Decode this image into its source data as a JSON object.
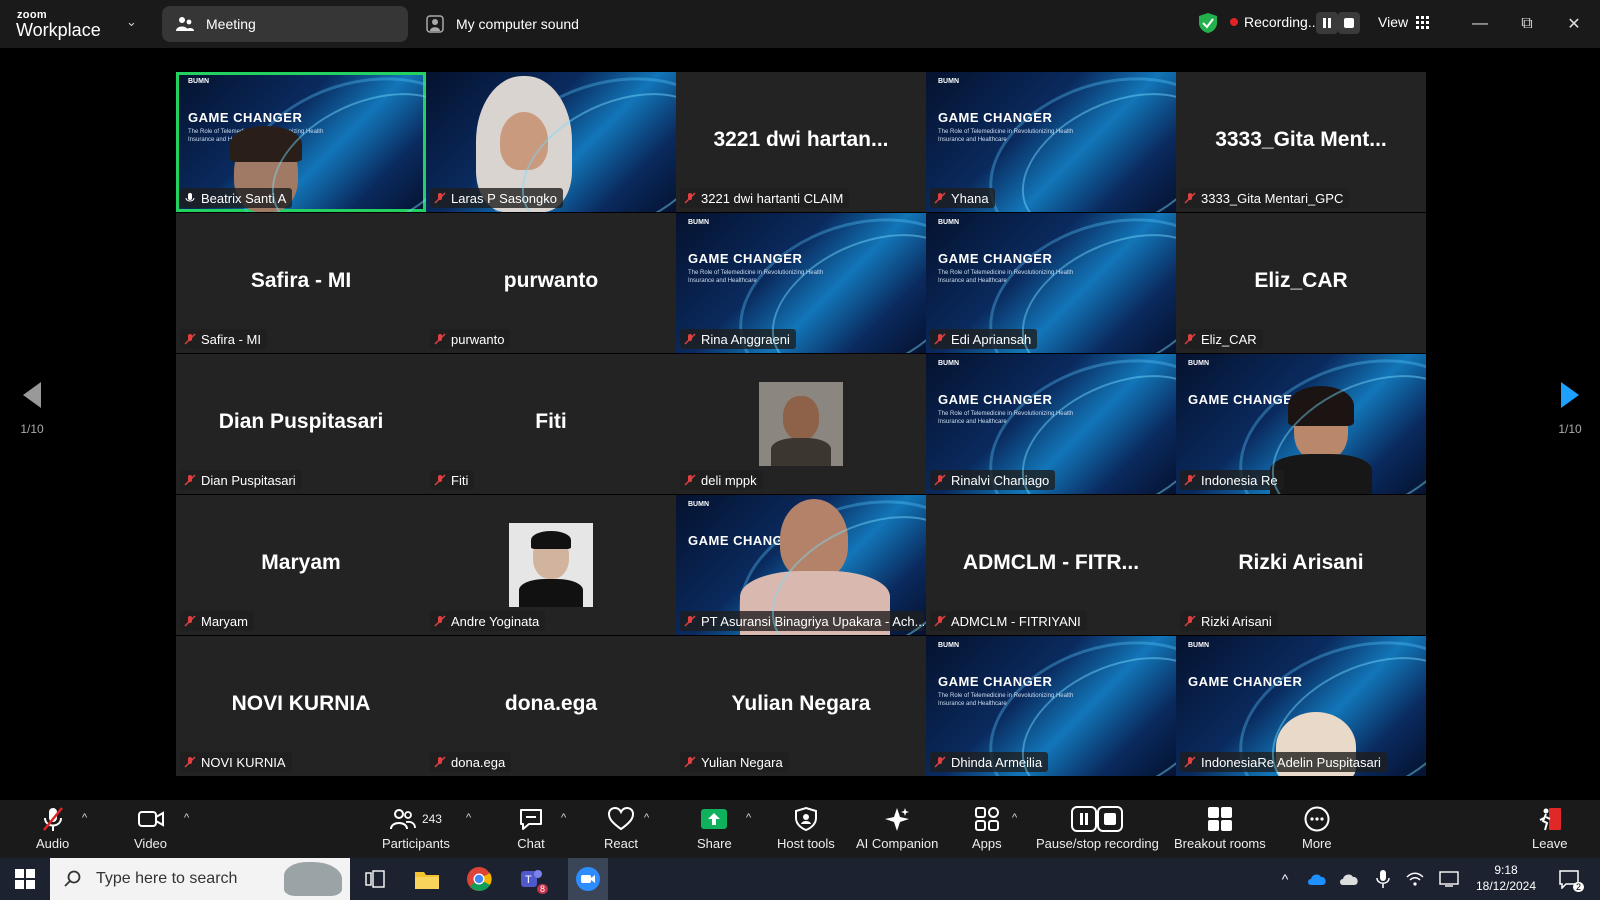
{
  "header": {
    "brand_small": "zoom",
    "brand_big": "Workplace",
    "meeting_label": "Meeting",
    "sound_label": "My computer sound",
    "recording_label": "Recording...",
    "view_label": "View"
  },
  "slide": {
    "org": "BUMN",
    "title": "GAME CHANGER",
    "subtitle": "The Role of Telemedicine in Revolutionizing Health Insurance and Healthcare"
  },
  "tiles": [
    {
      "name": "Beatrix Santi A"
    },
    {
      "name": "Laras P Sasongko"
    },
    {
      "name": "3221 dwi hartanti CLAIM",
      "big": "3221 dwi hartan..."
    },
    {
      "name": "Yhana"
    },
    {
      "name": "3333_Gita Mentari_GPC",
      "big": "3333_Gita Ment..."
    },
    {
      "name": "Safira - MI",
      "big": "Safira - MI"
    },
    {
      "name": "purwanto",
      "big": "purwanto"
    },
    {
      "name": "Rina Anggraeni"
    },
    {
      "name": "Edi Apriansah"
    },
    {
      "name": "Eliz_CAR",
      "big": "Eliz_CAR"
    },
    {
      "name": "Dian Puspitasari",
      "big": "Dian Puspitasari"
    },
    {
      "name": "Fiti",
      "big": "Fiti"
    },
    {
      "name": "deli mppk"
    },
    {
      "name": "Rinalvi Chaniago"
    },
    {
      "name": "Indonesia Re"
    },
    {
      "name": "Maryam",
      "big": "Maryam"
    },
    {
      "name": "Andre Yoginata"
    },
    {
      "name": "PT Asuransi Binagriya Upakara - Ach..."
    },
    {
      "name": "ADMCLM - FITRIYANI",
      "big": "ADMCLM - FITR..."
    },
    {
      "name": "Rizki Arisani",
      "big": "Rizki Arisani"
    },
    {
      "name": "NOVI KURNIA",
      "big": "NOVI KURNIA"
    },
    {
      "name": "dona.ega",
      "big": "dona.ega"
    },
    {
      "name": "Yulian Negara",
      "big": "Yulian Negara"
    },
    {
      "name": "Dhinda Armeilia"
    },
    {
      "name": "IndonesiaRe Adelin Puspitasari"
    }
  ],
  "paging": {
    "left": "1/10",
    "right": "1/10"
  },
  "toolbar": {
    "audio": "Audio",
    "video": "Video",
    "participants": "Participants",
    "participants_count": "243",
    "chat": "Chat",
    "react": "React",
    "share": "Share",
    "host_tools": "Host tools",
    "ai_companion": "AI Companion",
    "apps": "Apps",
    "pause_stop": "Pause/stop recording",
    "breakout": "Breakout rooms",
    "more": "More",
    "leave": "Leave"
  },
  "taskbar": {
    "search_placeholder": "Type here to search",
    "time": "9:18",
    "date": "18/12/2024",
    "teams_badge": "8",
    "notif_badge": "2"
  },
  "colors": {
    "active_speaker": "#23d160",
    "recording_dot": "#e02424",
    "share_green": "#0fb15d",
    "leave_red": "#e02828"
  }
}
